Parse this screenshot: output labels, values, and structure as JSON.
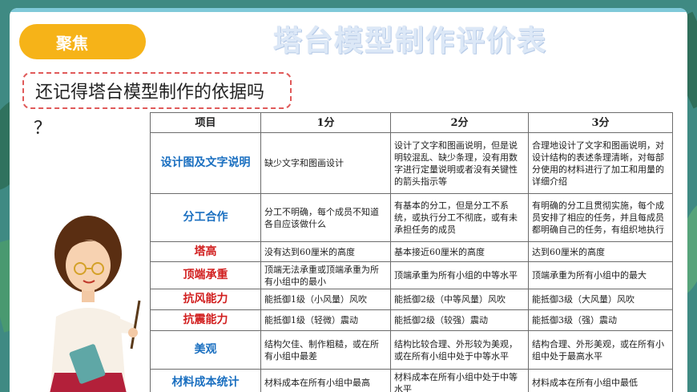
{
  "header": {
    "focus_label": "聚焦",
    "title": "塔台模型制作评价表"
  },
  "question": {
    "text": "还记得塔台模型制作的依据吗",
    "mark": "？"
  },
  "table": {
    "headers": [
      "项目",
      "1分",
      "2分",
      "3分"
    ],
    "rows": [
      {
        "item": "设计图及文字说明",
        "color": "#1a6fc0",
        "c1": "缺少文字和图画设计",
        "c2": "设计了文字和图画说明，但是说明较混乱、缺少条理，没有用数字进行定量说明或者没有关键性的箭头指示等",
        "c3": "合理地设计了文字和图画说明，对设计结构的表述条理清晰，对每部分使用的材料进行了加工和用量的详细介绍"
      },
      {
        "item": "分工合作",
        "color": "#1a6fc0",
        "c1": "分工不明确，每个成员不知道各自应该做什么",
        "c2": "有基本的分工，但是分工不系统，或执行分工不彻底，或有未承担任务的成员",
        "c3": "有明确的分工且贯彻实施，每个成员安排了相应的任务，并且每成员都明确自己的任务，有组织地执行"
      },
      {
        "item": "塔高",
        "color": "#d11e1e",
        "c1": "没有达到60厘米的高度",
        "c2": "基本接近60厘米的高度",
        "c3": "达到60厘米的高度"
      },
      {
        "item": "顶端承重",
        "color": "#d11e1e",
        "c1": "顶端无法承重或顶端承重为所有小组中的最小",
        "c2": "顶端承重为所有小组的中等水平",
        "c3": "顶端承重为所有小组中的最大"
      },
      {
        "item": "抗风能力",
        "color": "#d11e1e",
        "c1": "能抵御1级（小风量）风吹",
        "c2": "能抵御2级（中等风量）风吹",
        "c3": "能抵御3级（大风量）风吹"
      },
      {
        "item": "抗震能力",
        "color": "#d11e1e",
        "c1": "能抵御1级（轻微）震动",
        "c2": "能抵御2级（较强）震动",
        "c3": "能抵御3级（强）震动"
      },
      {
        "item": "美观",
        "color": "#1a6fc0",
        "c1": "结构欠佳、制作粗糙，或在所有小组中最差",
        "c2": "结构比较合理、外形较为美观，或在所有小组中处于中等水平",
        "c3": "结构合理、外形美观，或在所有小组中处于最高水平"
      },
      {
        "item": "材料成本统计",
        "color": "#1a6fc0",
        "c1": "材料成本在所有小组中最高",
        "c2": "材料成本在所有小组中处于中等水平",
        "c3": "材料成本在所有小组中最低"
      }
    ]
  }
}
